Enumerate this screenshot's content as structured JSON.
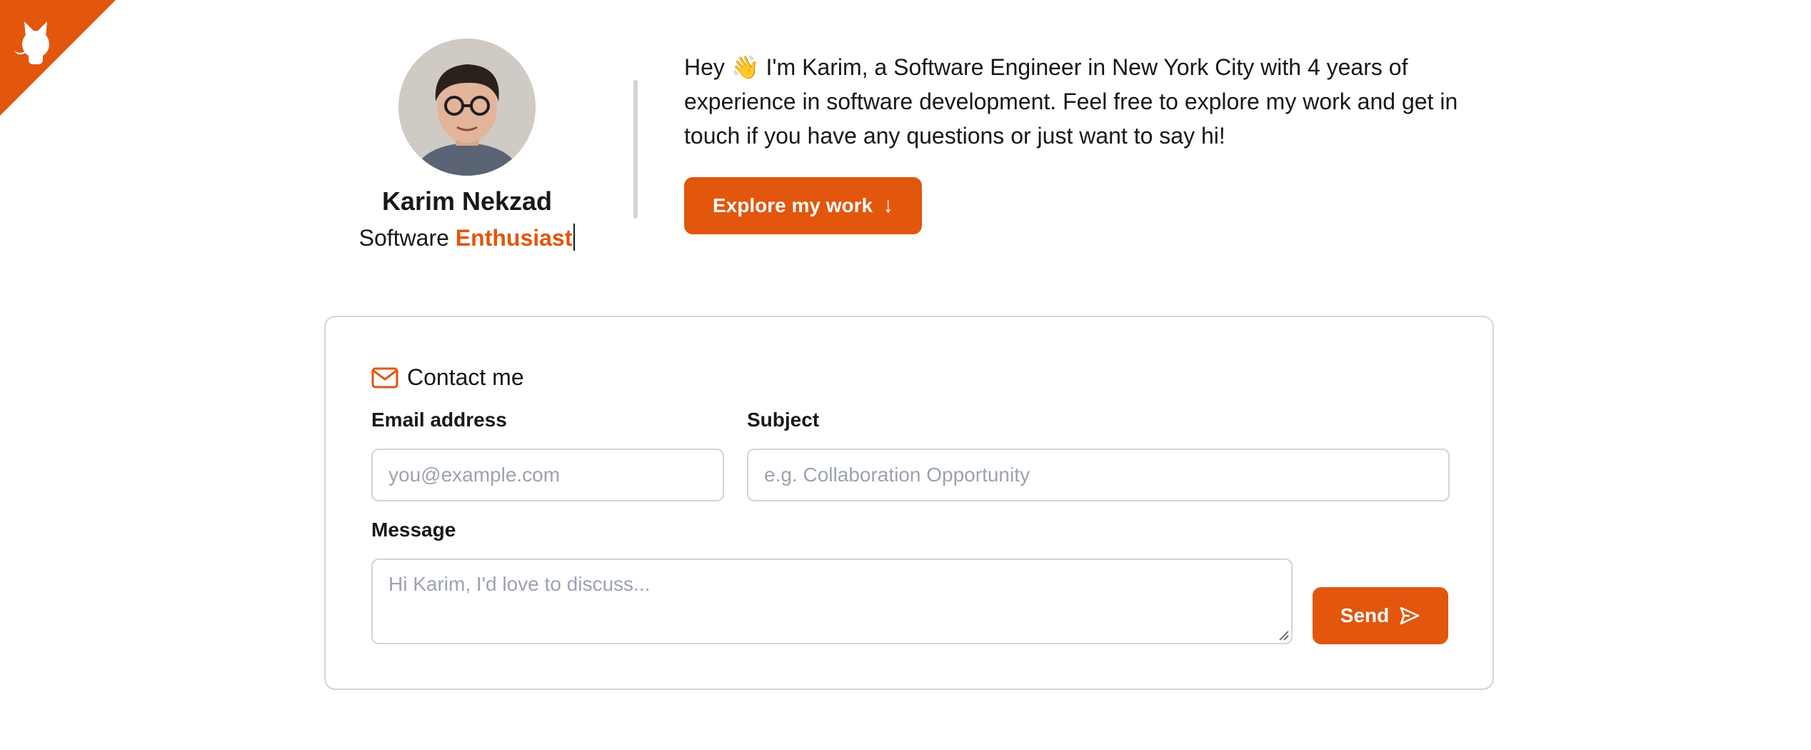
{
  "github_corner": {
    "icon": "github-octocat-icon",
    "color": "#e2560d"
  },
  "profile": {
    "name": "Karim Nekzad",
    "role_prefix": "Software",
    "role_highlight": "Enthusiast",
    "avatar_icon": "avatar-photo"
  },
  "intro": {
    "text": "Hey 👋 I'm Karim, a Software Engineer in New York City with 4 years of experience in software development. Feel free to explore my work and get in touch if you have any questions or just want to say hi!",
    "explore_label": "Explore my work",
    "explore_icon": "arrow-down-icon"
  },
  "contact": {
    "title": "Contact me",
    "title_icon": "mail-icon",
    "email_label": "Email address",
    "email_placeholder": "you@example.com",
    "subject_label": "Subject",
    "subject_placeholder": "e.g. Collaboration Opportunity",
    "message_label": "Message",
    "message_placeholder": "Hi Karim, I'd love to discuss...",
    "send_label": "Send",
    "send_icon": "send-icon"
  },
  "colors": {
    "accent": "#e2560d",
    "border": "#d4d4d8",
    "text": "#18181b",
    "placeholder": "#9ca3af"
  }
}
